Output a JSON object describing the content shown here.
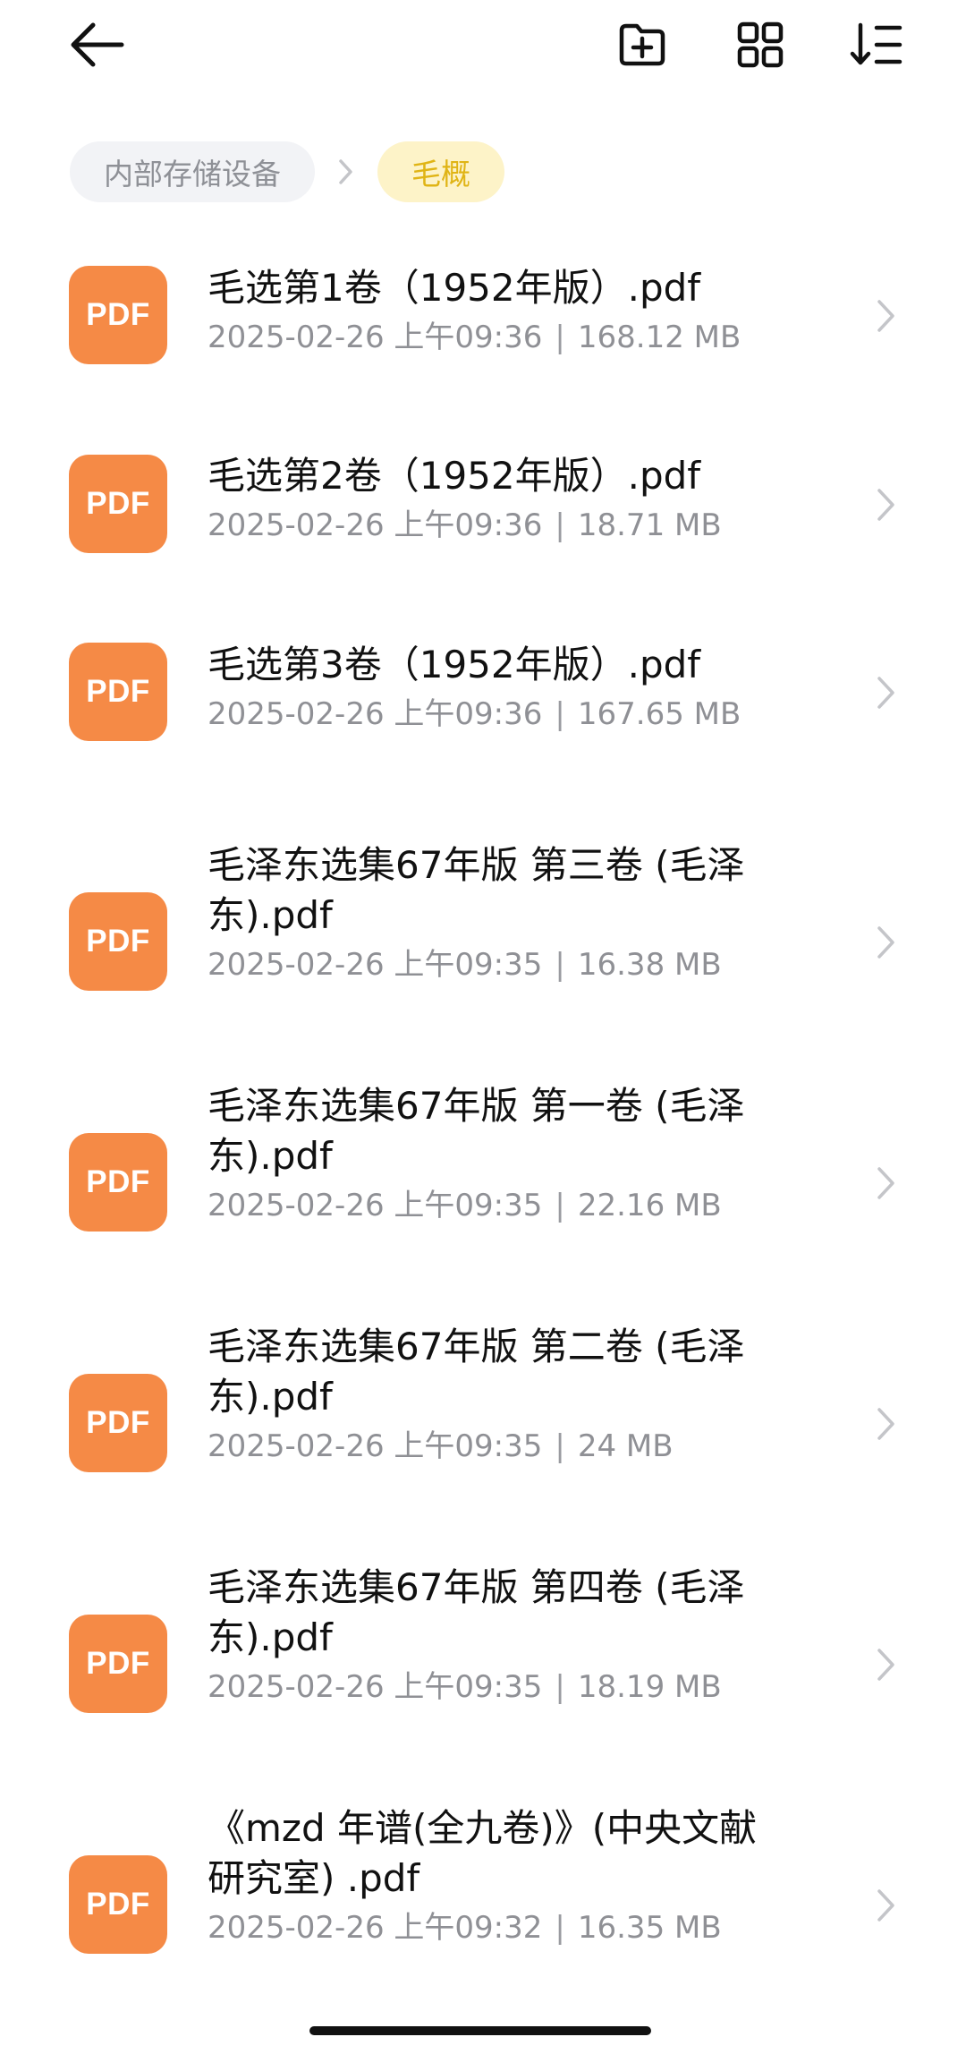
{
  "breadcrumb": {
    "root": "内部存储设备",
    "current": "毛概"
  },
  "file_icon_label": "PDF",
  "files": [
    {
      "name": "毛选第1卷（1952年版）.pdf",
      "date": "2025-02-26 上午09:36",
      "separator": "|",
      "size": "168.12 MB"
    },
    {
      "name": "毛选第2卷（1952年版）.pdf",
      "date": "2025-02-26 上午09:36",
      "separator": "|",
      "size": "18.71 MB"
    },
    {
      "name": "毛选第3卷（1952年版）.pdf",
      "date": "2025-02-26 上午09:36",
      "separator": "|",
      "size": "167.65 MB"
    },
    {
      "name": "毛泽东选集67年版 第三卷 (毛泽东).pdf",
      "date": "2025-02-26 上午09:35",
      "separator": "|",
      "size": "16.38 MB"
    },
    {
      "name": "毛泽东选集67年版 第一卷 (毛泽东).pdf",
      "date": "2025-02-26 上午09:35",
      "separator": "|",
      "size": "22.16 MB"
    },
    {
      "name": "毛泽东选集67年版 第二卷 (毛泽东).pdf",
      "date": "2025-02-26 上午09:35",
      "separator": "|",
      "size": "24 MB"
    },
    {
      "name": "毛泽东选集67年版 第四卷 (毛泽东).pdf",
      "date": "2025-02-26 上午09:35",
      "separator": "|",
      "size": "18.19 MB"
    },
    {
      "name": "《mzd 年谱(全九卷)》(中央文献研究室) .pdf",
      "date": "2025-02-26 上午09:32",
      "separator": "|",
      "size": "16.35 MB"
    }
  ],
  "icons": {
    "back": "arrow-left-icon",
    "new_folder": "folder-plus-icon",
    "view": "grid-view-icon",
    "sort": "sort-icon",
    "chevron": "chevron-right-icon"
  },
  "colors": {
    "pdf_icon": "#f58a46",
    "breadcrumb_current_bg": "#fdf3c8",
    "breadcrumb_current_text": "#e0b415",
    "breadcrumb_root_bg": "#f2f3f6",
    "meta_text": "#8f9095"
  }
}
